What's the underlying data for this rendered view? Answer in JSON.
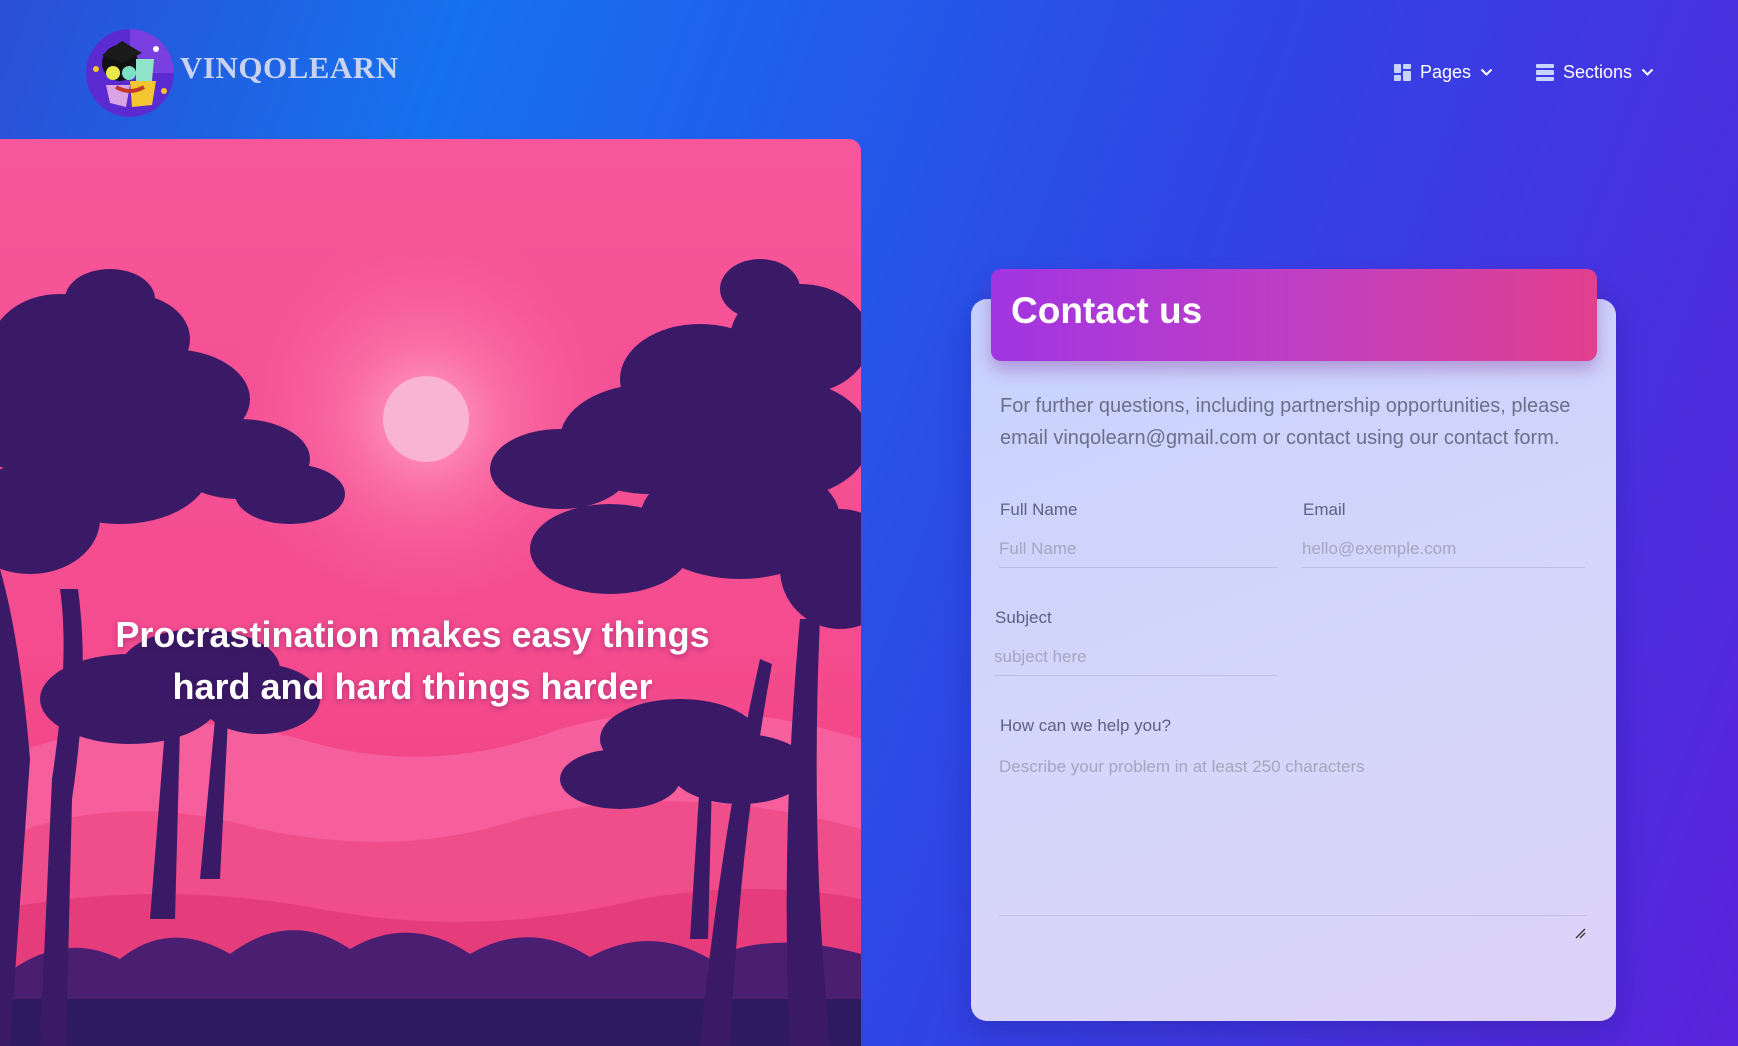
{
  "brand": {
    "name": "VINQOLEARN"
  },
  "nav": {
    "pages_label": "Pages",
    "sections_label": "Sections",
    "pages_icon": "dashboard-grid-icon",
    "sections_icon": "stacked-sections-icon"
  },
  "hero": {
    "quote_line1": "Procrastination makes easy things",
    "quote_line2": "hard and hard things harder"
  },
  "contact": {
    "title": "Contact us",
    "description": "For further questions, including partnership opportunities, please email vinqolearn@gmail.com or contact using our contact form.",
    "full_name_label": "Full Name",
    "full_name_placeholder": "Full Name",
    "email_label": "Email",
    "email_placeholder": "hello@exemple.com",
    "subject_label": "Subject",
    "subject_placeholder": "subject here",
    "message_label": "How can we help you?",
    "message_placeholder": "Describe your problem in at least 250 characters"
  },
  "colors": {
    "background_start": "#1671ee",
    "background_end": "#5a22dc",
    "hero_sky": "#f6579a",
    "tree_silhouette": "#3a1a66",
    "header_gradient_start": "#a135e3",
    "header_gradient_end": "#e23f8e"
  }
}
